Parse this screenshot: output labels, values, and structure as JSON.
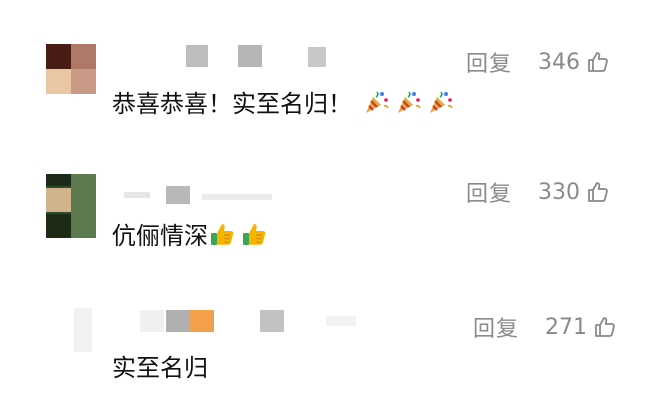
{
  "comments": [
    {
      "text": "恭喜恭喜！实至名归！",
      "reply_label": "回复",
      "likes": "346",
      "emoji": [
        "party-popper-icon",
        "party-popper-icon",
        "party-popper-icon"
      ]
    },
    {
      "text": "伉俪情深",
      "reply_label": "回复",
      "likes": "330",
      "emoji": [
        "thumbs-up-icon",
        "thumbs-up-icon"
      ]
    },
    {
      "text": "实至名归",
      "reply_label": "回复",
      "likes": "271",
      "emoji": []
    }
  ],
  "colors": {
    "meta_gray": "#8a8a8a",
    "text": "#111111",
    "thumb_yellow": "#f5b400",
    "thumb_green": "#3aa655"
  }
}
